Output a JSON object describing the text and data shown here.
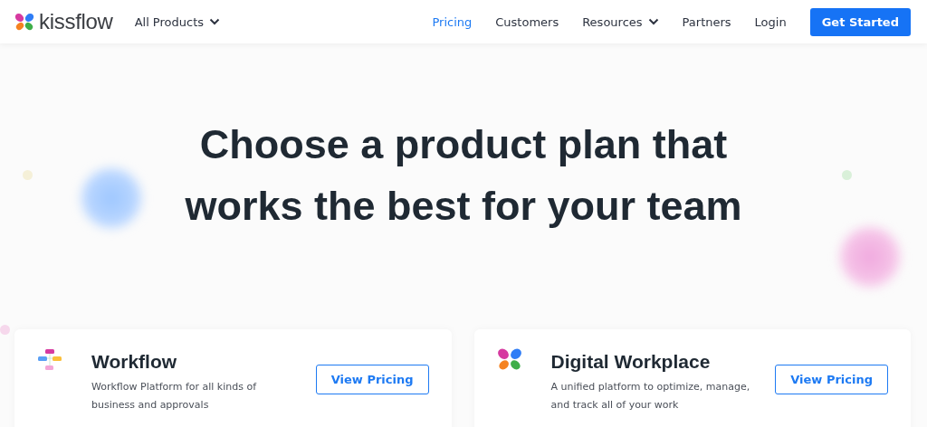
{
  "header": {
    "logo": "kissflow",
    "products_menu": {
      "label": "All Products",
      "dropdown": true
    },
    "nav": [
      {
        "label": "Pricing",
        "selected": true,
        "dropdown": false
      },
      {
        "label": "Customers",
        "selected": false,
        "dropdown": false
      },
      {
        "label": "Resources",
        "selected": false,
        "dropdown": true
      },
      {
        "label": "Partners",
        "selected": false,
        "dropdown": false
      },
      {
        "label": "Login",
        "selected": false,
        "dropdown": false
      }
    ],
    "cta": "Get Started"
  },
  "hero": {
    "title": "Choose a product plan that works the best for your team"
  },
  "products": [
    {
      "kind": "workflow",
      "name": "Workflow",
      "description": "Workflow Platform for all kinds of business and approvals",
      "button": "View Pricing"
    },
    {
      "kind": "workplace",
      "name": "Digital Workplace",
      "description": "A unified platform to optimize, manage, and track all of your work",
      "button": "View Pricing"
    }
  ]
}
